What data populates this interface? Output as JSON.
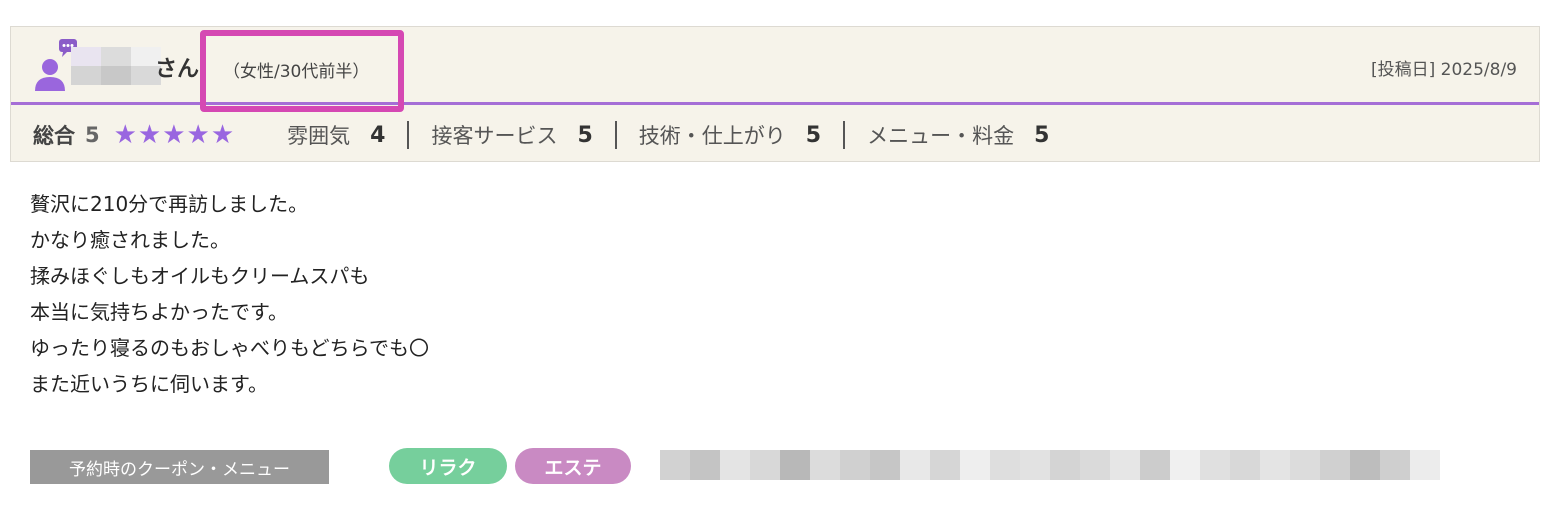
{
  "review": {
    "reviewer": {
      "honorific": "さん",
      "attributes": "（女性/30代前半）"
    },
    "post_date": "[投稿日] 2025/8/9",
    "ratings": {
      "overall_label": "総合",
      "overall_score": "5",
      "stars": "★★★★★",
      "stars_value": 5,
      "stars_max": 5,
      "items": [
        {
          "label": "雰囲気",
          "score": "4"
        },
        {
          "label": "接客サービス",
          "score": "5"
        },
        {
          "label": "技術・仕上がり",
          "score": "5"
        },
        {
          "label": "メニュー・料金",
          "score": "5"
        }
      ]
    },
    "body": [
      "贅沢に210分で再訪しました。",
      "かなり癒されました。",
      "揉みほぐしもオイルもクリームスパも",
      "本当に気持ちよかったです。",
      "ゆったり寝るのもおしゃべりもどちらでも〇",
      "また近いうちに伺います。"
    ],
    "coupon": {
      "label": "予約時のクーポン・メニュー",
      "tags": [
        "リラク",
        "エステ"
      ]
    }
  },
  "icons": {
    "avatar": "user-comment-icon",
    "rating_star": "star-icon"
  },
  "colors": {
    "accent_purple": "#a56ed6",
    "star": "#9966e0",
    "highlight": "#d548b3",
    "tag_relax": "#76cf9c",
    "tag_esthe": "#c98ac3",
    "header_bg": "#f6f3ea",
    "coupon_label_bg": "#999999"
  }
}
